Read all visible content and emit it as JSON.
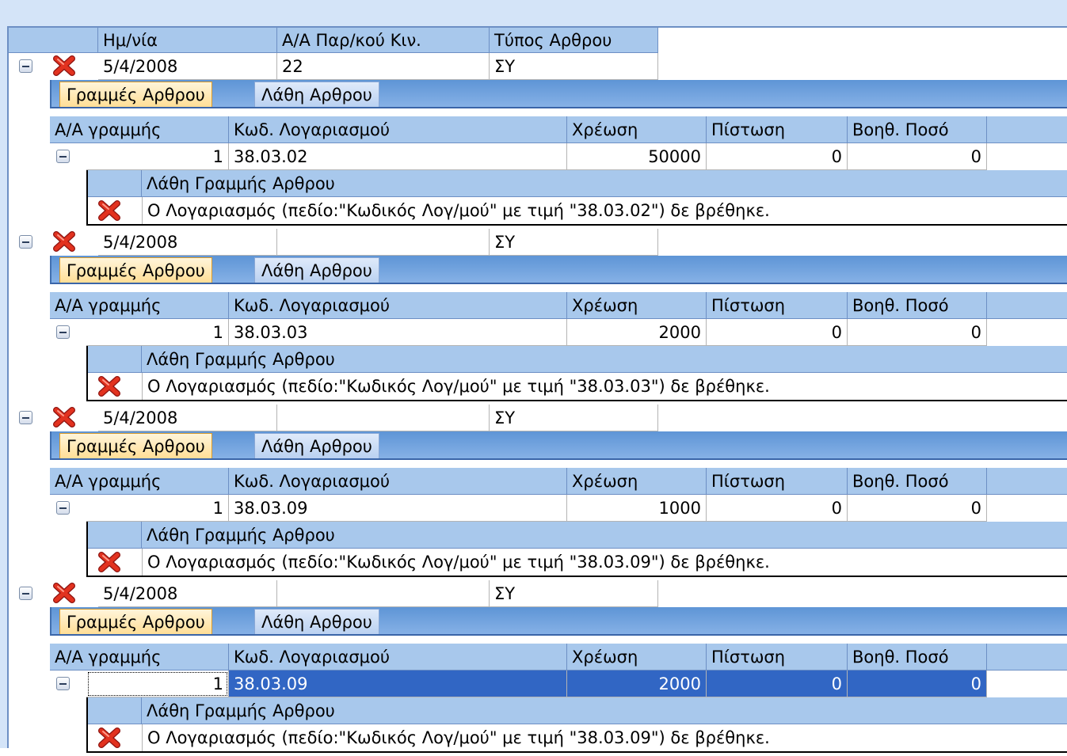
{
  "master_columns": [
    "Ημ/νία",
    "Α/Α Παρ/κού Κιν.",
    "Τύπος Αρθρου"
  ],
  "detail_tabs": [
    "Γραμμές Αρθρου",
    "Λάθη Αρθρου"
  ],
  "detail_columns": [
    "Α/Α γραμμής",
    "Κωδ. Λογαριασμού",
    "Χρέωση",
    "Πίστωση",
    "Βοηθ. Ποσό"
  ],
  "error_header": "Λάθη Γραμμής Αρθρου",
  "icons": {
    "expander": "collapse-minus-icon",
    "error": "red-x-error-icon"
  },
  "colors": {
    "header": "#a8c8ec",
    "tab_active": "#ffde96",
    "selection": "#3166c4",
    "error": "#d42a1e"
  },
  "articles": [
    {
      "date": "5/4/2008",
      "aa": "22",
      "type": "ΣΥ",
      "line": {
        "aa": "1",
        "account": "38.03.02",
        "debit": "50000",
        "credit": "0",
        "aux": "0"
      },
      "error": "Ο Λογαριασμός (πεδίο:\"Κωδικός Λογ/μού\" με τιμή \"38.03.02\") δε βρέθηκε."
    },
    {
      "date": "5/4/2008",
      "aa": "",
      "type": "ΣΥ",
      "line": {
        "aa": "1",
        "account": "38.03.03",
        "debit": "2000",
        "credit": "0",
        "aux": "0"
      },
      "error": "Ο Λογαριασμός (πεδίο:\"Κωδικός Λογ/μού\" με τιμή \"38.03.03\") δε βρέθηκε."
    },
    {
      "date": "5/4/2008",
      "aa": "",
      "type": "ΣΥ",
      "line": {
        "aa": "1",
        "account": "38.03.09",
        "debit": "1000",
        "credit": "0",
        "aux": "0"
      },
      "error": "Ο Λογαριασμός (πεδίο:\"Κωδικός Λογ/μού\" με τιμή \"38.03.09\") δε βρέθηκε."
    },
    {
      "date": "5/4/2008",
      "aa": "",
      "type": "ΣΥ",
      "line": {
        "aa": "1",
        "account": "38.03.09",
        "debit": "2000",
        "credit": "0",
        "aux": "0",
        "selected": true
      },
      "error": "Ο Λογαριασμός (πεδίο:\"Κωδικός Λογ/μού\" με τιμή \"38.03.09\") δε βρέθηκε."
    }
  ]
}
